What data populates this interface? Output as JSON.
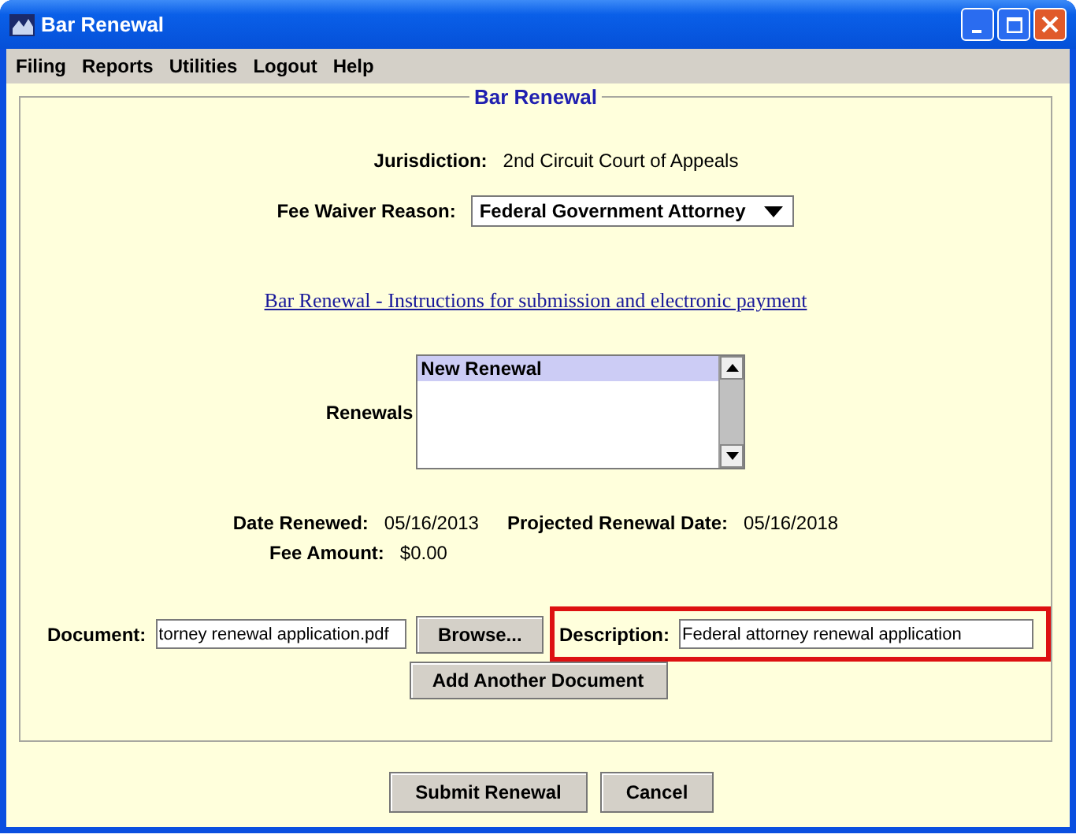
{
  "window": {
    "title": "Bar Renewal"
  },
  "menu": [
    "Filing",
    "Reports",
    "Utilities",
    "Logout",
    "Help"
  ],
  "panel": {
    "legend": "Bar Renewal",
    "jurisdiction": {
      "label": "Jurisdiction:",
      "value": "2nd Circuit Court of Appeals"
    },
    "fee_waiver": {
      "label": "Fee Waiver Reason:",
      "value": "Federal Government Attorney"
    },
    "link": "Bar Renewal - Instructions for submission and electronic payment",
    "renewals": {
      "label": "Renewals",
      "items": [
        {
          "text": "New Renewal",
          "selected": true
        }
      ]
    },
    "date_renewed": {
      "label": "Date Renewed:",
      "value": "05/16/2013"
    },
    "projected": {
      "label": "Projected Renewal Date:",
      "value": "05/16/2018"
    },
    "fee_amount": {
      "label": "Fee Amount:",
      "value": "$0.00"
    },
    "document": {
      "label": "Document:",
      "value": "torney renewal application.pdf"
    },
    "browse": "Browse...",
    "description": {
      "label": "Description:",
      "value": "Federal attorney renewal application",
      "highlighted": true
    },
    "add_button": "Add Another Document"
  },
  "buttons": [
    "Submit Renewal",
    "Cancel"
  ]
}
